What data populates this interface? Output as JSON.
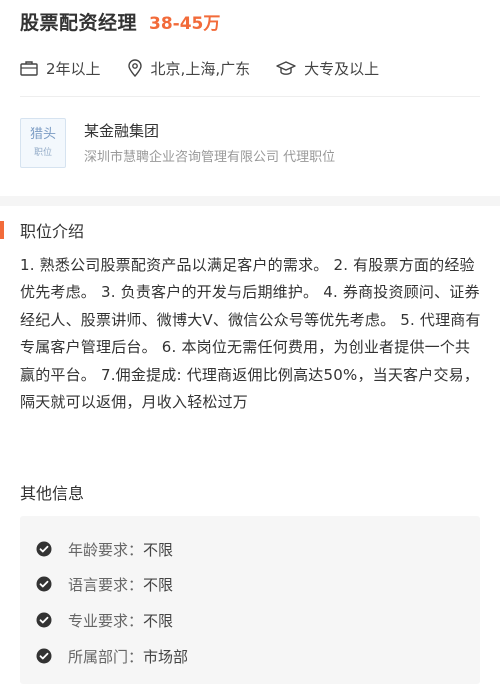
{
  "job": {
    "title": "股票配资经理",
    "salary": "38-45万"
  },
  "meta": {
    "experience": "2年以上",
    "location": "北京,上海,广东",
    "education": "大专及以上"
  },
  "company": {
    "logo_top": "猎头",
    "logo_bottom": "职位",
    "name": "某金融集团",
    "sub": "深圳市慧聘企业咨询管理有限公司 代理职位"
  },
  "description": {
    "title": "职位介绍",
    "text": "1. 熟悉公司股票配资产品以满足客户的需求。 2. 有股票方面的经验优先考虑。 3. 负责客户的开发与后期维护。 4. 券商投资顾问、证券经纪人、股票讲师、微博大V、微信公众号等优先考虑。 5. 代理商有专属客户管理后台。 6. 本岗位无需任何费用，为创业者提供一个共赢的平台。 7.佣金提成: 代理商返佣比例高达50%，当天客户交易，隔天就可以返佣，月收入轻松过万"
  },
  "other": {
    "title": "其他信息",
    "items": [
      {
        "label": "年龄要求：",
        "value": "不限"
      },
      {
        "label": "语言要求：",
        "value": "不限"
      },
      {
        "label": "专业要求：",
        "value": "不限"
      },
      {
        "label": "所属部门：",
        "value": "市场部"
      }
    ]
  },
  "colors": {
    "accent": "#f26b3a",
    "text": "#333333",
    "muted": "#999999"
  }
}
